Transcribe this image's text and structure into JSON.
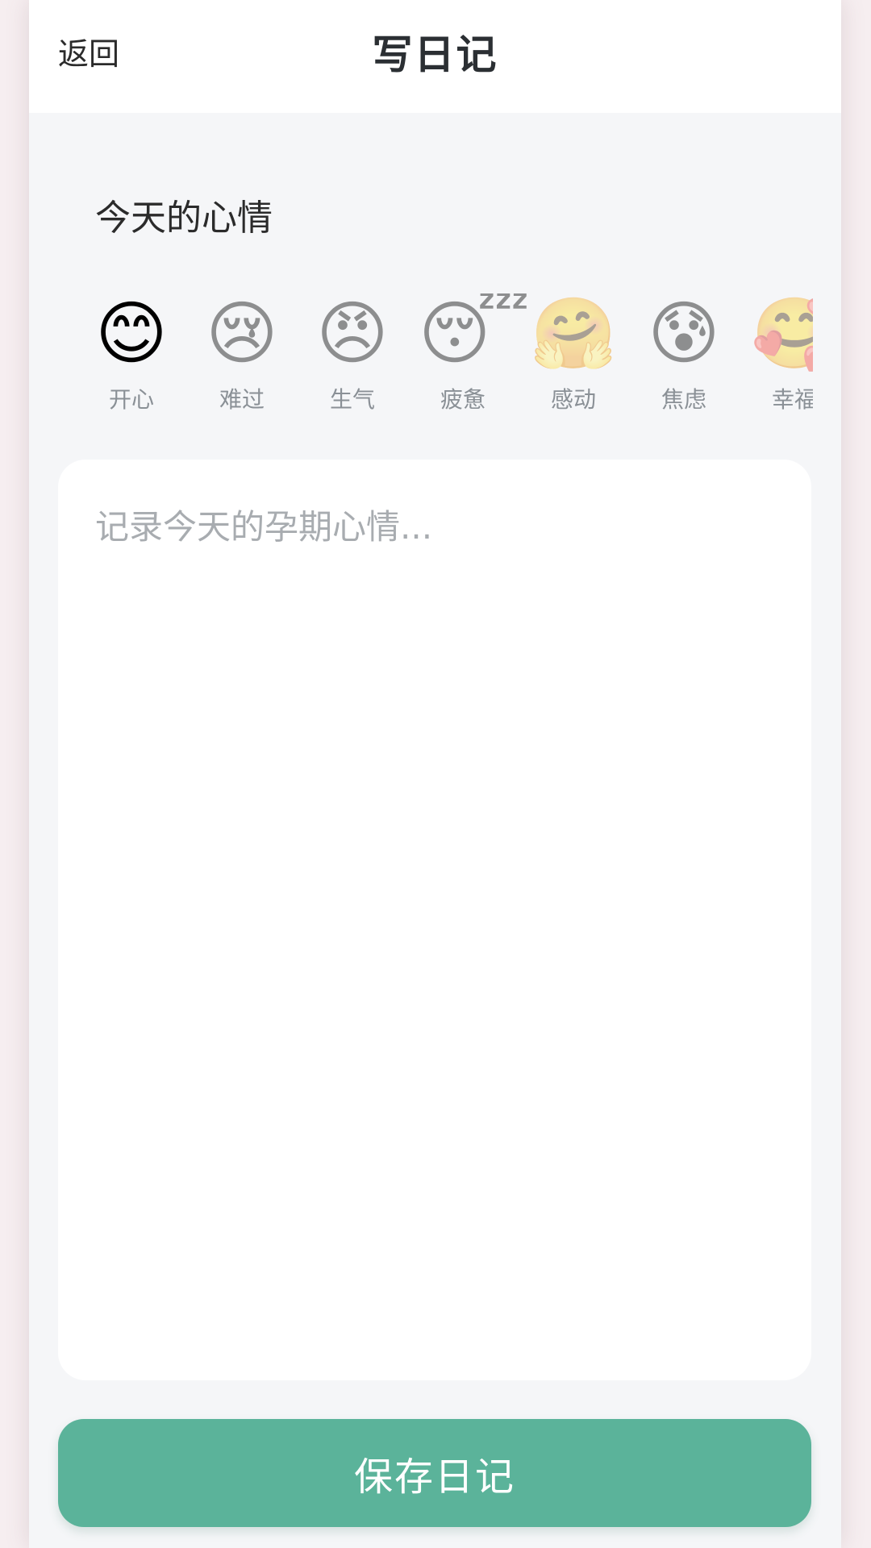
{
  "header": {
    "back_label": "返回",
    "title": "写日记"
  },
  "mood": {
    "heading": "今天的心情",
    "selected": "开心",
    "items": [
      {
        "label": "开心",
        "icon": "smiling-face-icon",
        "emoji": "😊"
      },
      {
        "label": "难过",
        "icon": "crying-face-icon",
        "emoji": "😢"
      },
      {
        "label": "生气",
        "icon": "angry-face-icon",
        "emoji": "😠"
      },
      {
        "label": "疲惫",
        "icon": "sleeping-face-icon",
        "emoji": "😴"
      },
      {
        "label": "感动",
        "icon": "hugging-face-icon",
        "emoji": "🤗"
      },
      {
        "label": "焦虑",
        "icon": "anxious-face-icon",
        "emoji": "😰"
      },
      {
        "label": "幸福",
        "icon": "face-with-hearts-icon",
        "emoji": "🥰"
      }
    ]
  },
  "editor": {
    "placeholder": "记录今天的孕期心情...",
    "value": ""
  },
  "actions": {
    "save_label": "保存日记"
  },
  "colors": {
    "accent": "#5bb39a",
    "background": "#f5f6f8",
    "card": "#ffffff"
  }
}
